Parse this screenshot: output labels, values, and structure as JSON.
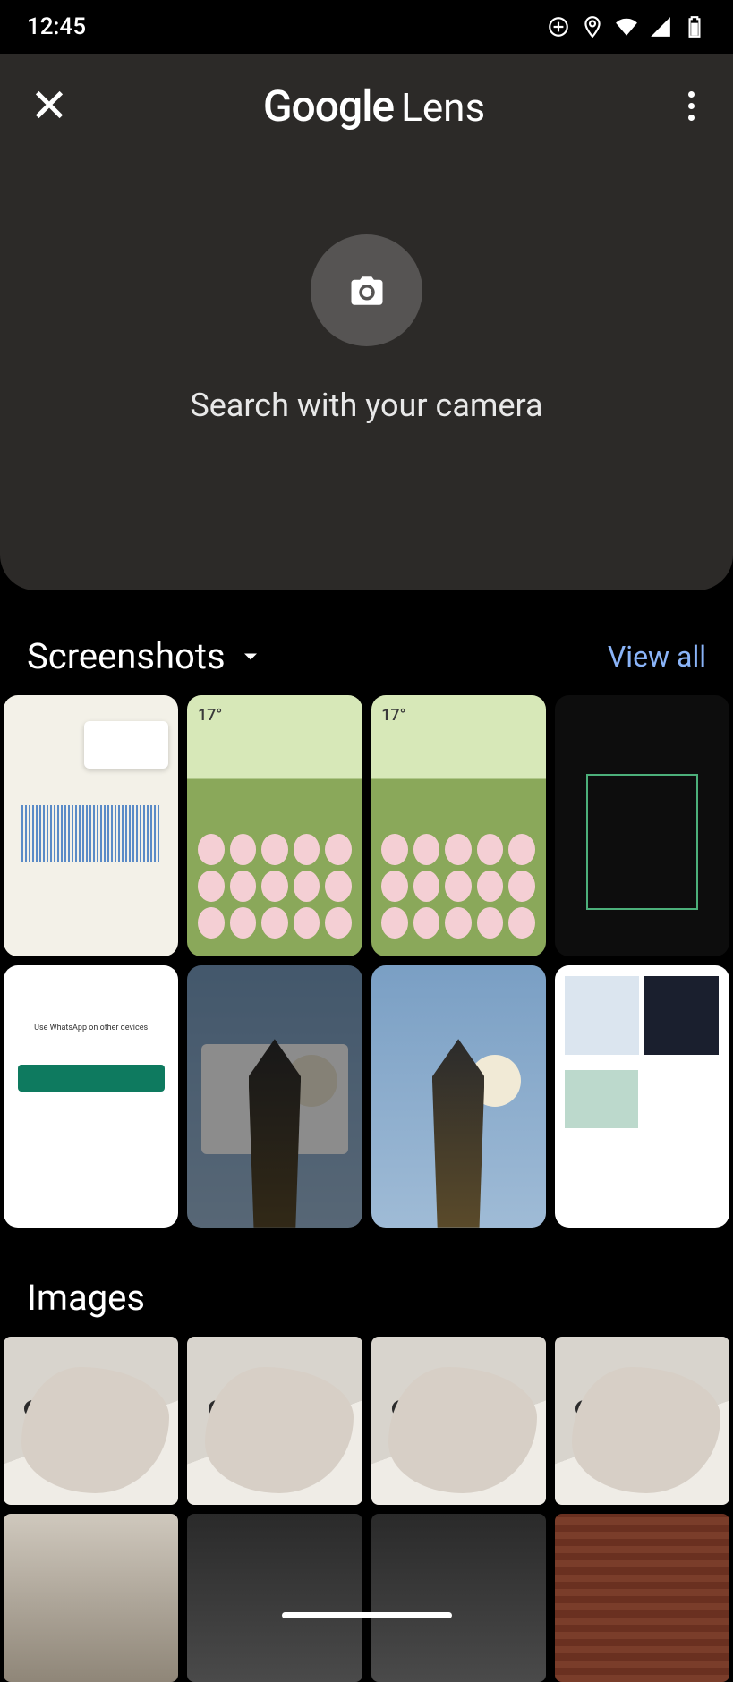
{
  "status_bar": {
    "time": "12:45"
  },
  "header": {
    "brand_google": "Google",
    "brand_lens": "Lens"
  },
  "camera": {
    "prompt": "Search with your camera"
  },
  "sections": {
    "screenshots": {
      "label": "Screenshots",
      "view_all": "View all"
    },
    "images": {
      "label": "Images"
    }
  },
  "thumbnails": {
    "home_weather": "17°",
    "whatsapp_text": "Use WhatsApp on other devices"
  }
}
